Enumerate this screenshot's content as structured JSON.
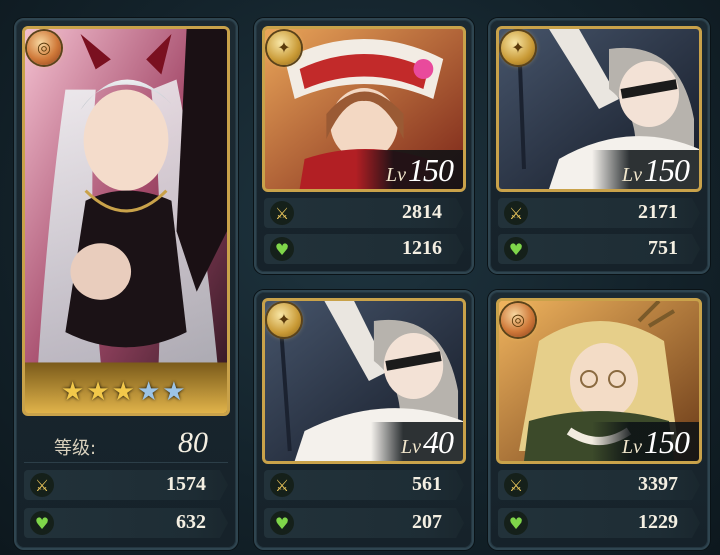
{
  "leader": {
    "element": "fire",
    "stars": [
      "gold",
      "gold",
      "gold",
      "blue",
      "blue"
    ],
    "level_label": "等级:",
    "level_value": "80",
    "attack": "1574",
    "hp": "632",
    "colors": {
      "bg1": "#f2b7c9",
      "bg2": "#5a2838"
    }
  },
  "units": [
    {
      "element": "light",
      "lv_prefix": "Lv",
      "level": "150",
      "attack": "2814",
      "hp": "1216",
      "colors": {
        "bg1": "#d68a45",
        "bg2": "#8a2a1e"
      }
    },
    {
      "element": "light",
      "lv_prefix": "Lv",
      "level": "150",
      "attack": "2171",
      "hp": "751",
      "colors": {
        "bg1": "#5c6a80",
        "bg2": "#1d2434"
      }
    },
    {
      "element": "light",
      "lv_prefix": "Lv",
      "level": "40",
      "attack": "561",
      "hp": "207",
      "colors": {
        "bg1": "#5c6a80",
        "bg2": "#1d2434"
      }
    },
    {
      "element": "fire",
      "lv_prefix": "Lv",
      "level": "150",
      "attack": "3397",
      "hp": "1229",
      "colors": {
        "bg1": "#e7a34e",
        "bg2": "#6a3a18"
      }
    }
  ],
  "icons": {
    "attack": "crossed-swords-icon",
    "hp": "heart-icon",
    "star": "star-icon"
  }
}
